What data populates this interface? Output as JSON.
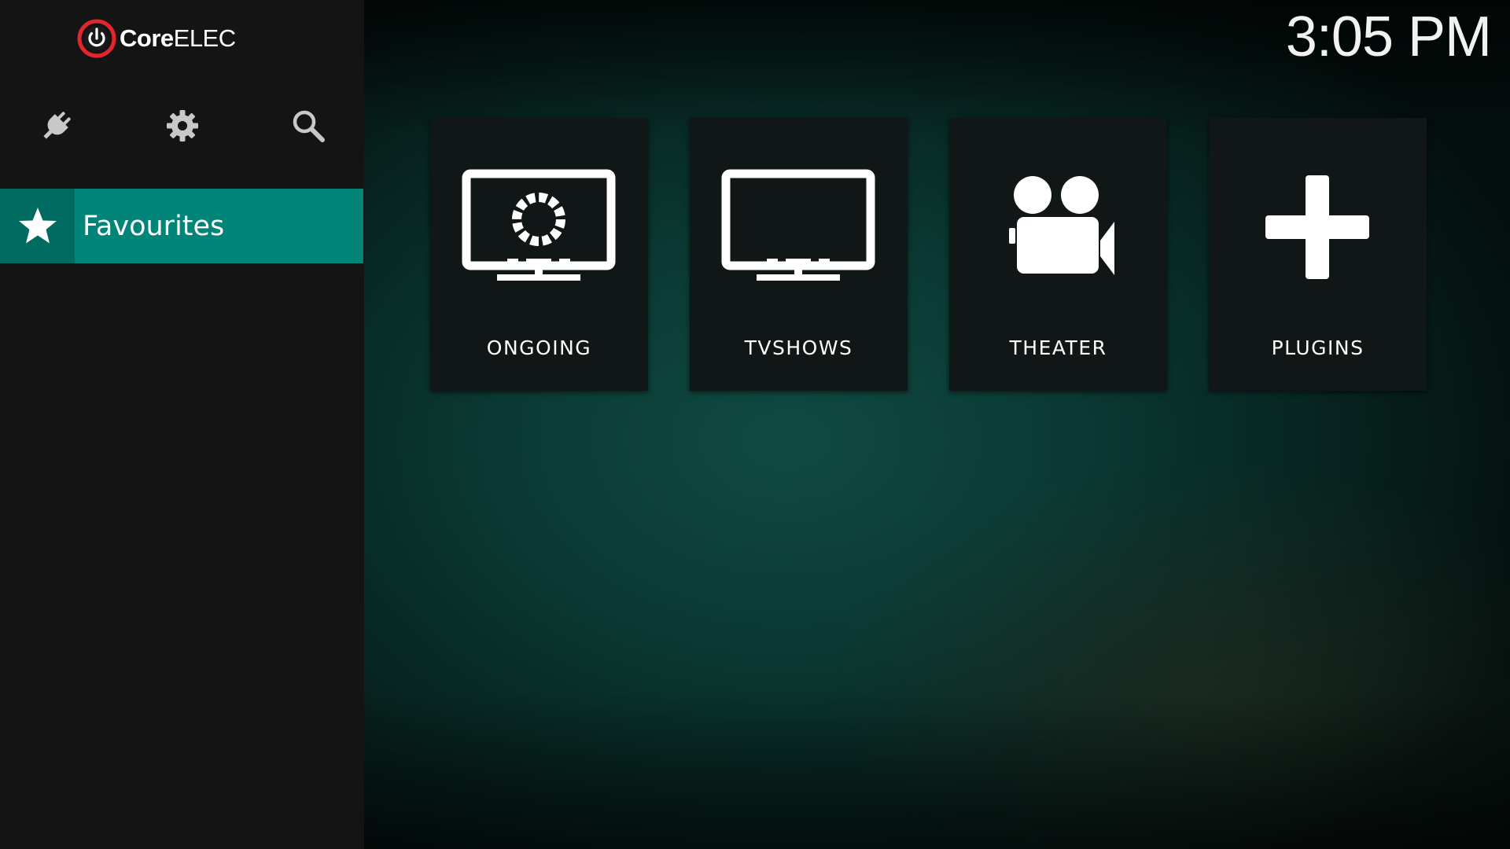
{
  "app": {
    "logo_text_core": "Core",
    "logo_text_elec": "ELEC",
    "clock": "3:05 PM"
  },
  "sidebar": {
    "tool_icons": [
      {
        "icon": "plug-icon",
        "label": "Add-ons"
      },
      {
        "icon": "gear-icon",
        "label": "Settings"
      },
      {
        "icon": "search-icon",
        "label": "Search"
      }
    ],
    "menu": [
      {
        "label": "Favourites",
        "icon": "star-icon",
        "selected": true
      }
    ]
  },
  "favourites": [
    {
      "label": "ONGOING",
      "icon": "tv-loading-icon"
    },
    {
      "label": "TVSHOWS",
      "icon": "tv-icon"
    },
    {
      "label": "THEATER",
      "icon": "video-camera-icon"
    },
    {
      "label": "PLUGINS",
      "icon": "plus-icon"
    }
  ],
  "colors": {
    "accent": "#008578",
    "accent_dark": "#006b61",
    "logo_red": "#e3262d",
    "sidebar_bg": "#141414",
    "tile_bg": "#111716"
  }
}
